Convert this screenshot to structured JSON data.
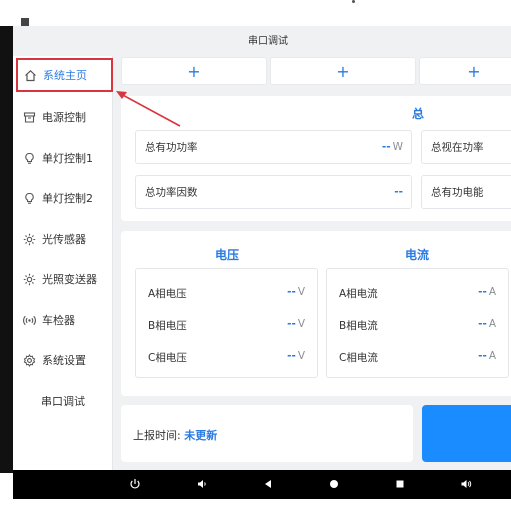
{
  "header": {
    "title": "串口调试"
  },
  "sidebar": {
    "items": [
      {
        "label": "系统主页",
        "icon": "home-icon"
      },
      {
        "label": "电源控制",
        "icon": "archive-icon"
      },
      {
        "label": "单灯控制1",
        "icon": "bulb-icon"
      },
      {
        "label": "单灯控制2",
        "icon": "bulb-icon"
      },
      {
        "label": "光传感器",
        "icon": "sun-icon"
      },
      {
        "label": "光照变送器",
        "icon": "sun-icon"
      },
      {
        "label": "车检器",
        "icon": "signal-icon"
      },
      {
        "label": "系统设置",
        "icon": "gear-icon"
      },
      {
        "label": "串口调试",
        "icon": ""
      }
    ]
  },
  "tabs": {
    "add_symbol": "+"
  },
  "total": {
    "title": "总",
    "active_power": {
      "label": "总有功功率",
      "value": "--",
      "unit": "W"
    },
    "apparent_power": {
      "label": "总视在功率"
    },
    "power_factor": {
      "label": "总功率因数",
      "value": "--"
    },
    "active_energy": {
      "label": "总有功电能"
    }
  },
  "voltage": {
    "title": "电压",
    "rows": [
      {
        "label": "A相电压",
        "value": "--",
        "unit": "V"
      },
      {
        "label": "B相电压",
        "value": "--",
        "unit": "V"
      },
      {
        "label": "C相电压",
        "value": "--",
        "unit": "V"
      }
    ]
  },
  "current": {
    "title": "电流",
    "rows": [
      {
        "label": "A相电流",
        "value": "--",
        "unit": "A"
      },
      {
        "label": "B相电流",
        "value": "--",
        "unit": "A"
      },
      {
        "label": "C相电流",
        "value": "--",
        "unit": "A"
      }
    ]
  },
  "report": {
    "label": "上报时间: ",
    "value": "未更新"
  },
  "colors": {
    "accent": "#2a7ae2",
    "highlight": "#d8353e",
    "button": "#1a8cff"
  }
}
